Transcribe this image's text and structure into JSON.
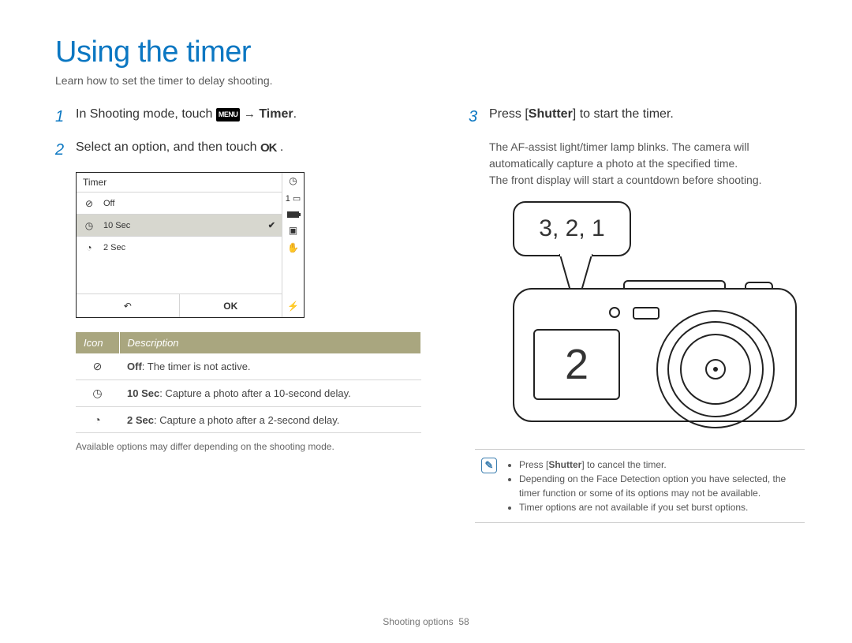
{
  "title": "Using the timer",
  "subtitle": "Learn how to set the timer to delay shooting.",
  "steps": {
    "s1": {
      "num": "1",
      "pre": "In Shooting mode, touch ",
      "menu": "MENU",
      "arrow": "→",
      "target": "Timer",
      "post": "."
    },
    "s2": {
      "num": "2",
      "pre": "Select an option, and then touch ",
      "ok": "OK",
      "post": " ."
    },
    "s3": {
      "num": "3",
      "pre": "Press [",
      "bold": "Shutter",
      "post": "] to start the timer."
    }
  },
  "step3_detail_line1": "The AF-assist light/timer lamp blinks. The camera will automatically capture a photo at the specified time.",
  "step3_detail_line2": "The front display will start a countdown before shooting.",
  "screen": {
    "title": "Timer",
    "options": [
      {
        "label": "Off"
      },
      {
        "label": "10 Sec"
      },
      {
        "label": "2 Sec"
      }
    ],
    "back": "↶",
    "ok": "OK",
    "side_top": "1"
  },
  "table": {
    "head_icon": "Icon",
    "head_desc": "Description",
    "rows": [
      {
        "bold": "Off",
        "rest": ": The timer is not active."
      },
      {
        "bold": "10 Sec",
        "rest": ": Capture a photo after a 10-second delay."
      },
      {
        "bold": "2 Sec",
        "rest": ": Capture a photo after a 2-second delay."
      }
    ]
  },
  "table_footnote": "Available options may differ depending on the shooting mode.",
  "bubble": "3, 2, 1",
  "front_display": "2",
  "notes": {
    "icon": "✎",
    "items": [
      {
        "pre": "Press [",
        "bold": "Shutter",
        "post": "] to cancel the timer."
      },
      {
        "text": "Depending on the Face Detection option you have selected, the timer function or some of its options may not be available."
      },
      {
        "text": "Timer options are not available if you set burst options."
      }
    ]
  },
  "footer": {
    "section": "Shooting options",
    "page": "58"
  }
}
